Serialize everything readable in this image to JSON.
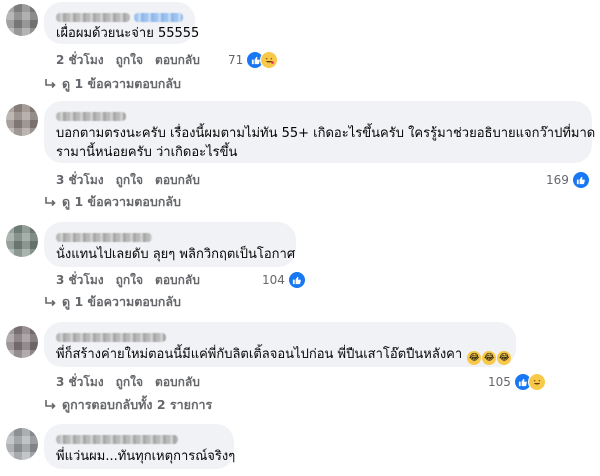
{
  "comments": [
    {
      "text": "เผื่อผมด้วยนะจ่าย 55555",
      "time": "2 ชั่วโมง",
      "like": "ถูกใจ",
      "reply": "ตอบกลับ",
      "reaction_count": "71",
      "reaction_icons": [
        "like-icon",
        "haha-icon"
      ],
      "replies_link": "ดู 1 ข้อความตอบกลับ"
    },
    {
      "text_line1": "บอกตามตรงนะครับ เรื่องนี้ผมตามไม่ทัน 55+ เกิดอะไรขึ้นครับ ใครรู้มาช่วยอธิบายแจกว๊าปที่มาด",
      "text_line2": "รามานี้หน่อยครับ ว่าเกิดอะไรขึ้น",
      "time": "3 ชั่วโมง",
      "like": "ถูกใจ",
      "reply": "ตอบกลับ",
      "reaction_count": "169",
      "reaction_icons": [
        "like-icon"
      ],
      "replies_link": "ดู 1 ข้อความตอบกลับ"
    },
    {
      "text": "นั่งแทนไปเลยดับ ลุยๆ พลิกวิกฤตเป็นโอกาศ",
      "time": "3 ชั่วโมง",
      "like": "ถูกใจ",
      "reply": "ตอบกลับ",
      "reaction_count": "104",
      "reaction_icons": [
        "like-icon"
      ],
      "replies_link": "ดู 1 ข้อความตอบกลับ"
    },
    {
      "text": "พี่ก็สร้างค่ายใหม่ตอนนี้มีแค่พี่กับลิตเติ้ลจอนไปก่อน พี่ปืนเสาโอ๊ตปืนหลังคา",
      "inline_emoji": [
        "😂",
        "😂",
        "😂"
      ],
      "time": "3 ชั่วโมง",
      "like": "ถูกใจ",
      "reply": "ตอบกลับ",
      "reaction_count": "105",
      "reaction_icons": [
        "like-icon",
        "haha-icon"
      ],
      "replies_link": "ดูการตอบกลับทั้ง 2 รายการ"
    },
    {
      "text": "พี่แว่นผม...ทันทุกเหตุการณ์จริงๆ"
    }
  ],
  "colors": {
    "bubble": "#f0f2f5",
    "secondary_text": "#65676b",
    "like_blue": "#1877f2",
    "emoji_yellow": "#f7c84a"
  }
}
